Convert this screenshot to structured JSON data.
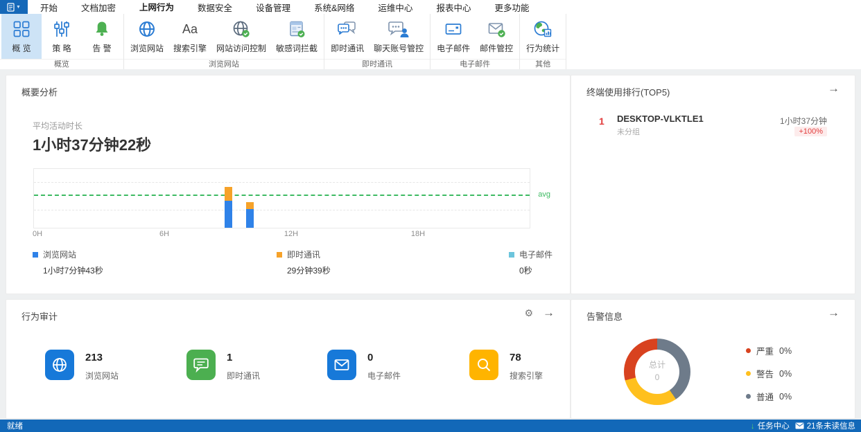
{
  "app": {
    "tabs": [
      {
        "label": "开始",
        "active": false
      },
      {
        "label": "文档加密",
        "active": false
      },
      {
        "label": "上网行为",
        "active": true
      },
      {
        "label": "数据安全",
        "active": false
      },
      {
        "label": "设备管理",
        "active": false
      },
      {
        "label": "系统&网络",
        "active": false
      },
      {
        "label": "运维中心",
        "active": false
      },
      {
        "label": "报表中心",
        "active": false
      },
      {
        "label": "更多功能",
        "active": false
      }
    ]
  },
  "ribbon": {
    "groups": [
      {
        "label": "概览",
        "items": [
          {
            "label": "概 览",
            "selected": true
          },
          {
            "label": "策 略"
          },
          {
            "label": "告 警"
          }
        ]
      },
      {
        "label": "浏览网站",
        "items": [
          {
            "label": "浏览网站"
          },
          {
            "label": "搜索引擎"
          },
          {
            "label": "网站访问控制"
          },
          {
            "label": "敏感词拦截"
          }
        ]
      },
      {
        "label": "即时通讯",
        "items": [
          {
            "label": "即时通讯"
          },
          {
            "label": "聊天账号管控"
          }
        ]
      },
      {
        "label": "电子邮件",
        "items": [
          {
            "label": "电子邮件"
          },
          {
            "label": "邮件管控"
          }
        ]
      },
      {
        "label": "其他",
        "items": [
          {
            "label": "行为统计"
          }
        ]
      }
    ]
  },
  "summary_panel": {
    "title": "概要分析",
    "avg_label": "平均活动时长",
    "avg_value": "1小时37分钟22秒"
  },
  "ranking_panel": {
    "title": "终端使用排行(TOP5)",
    "items": [
      {
        "rank": "1",
        "name": "DESKTOP-VLKTLE1",
        "group": "未分组",
        "duration": "1小时37分钟",
        "change": "+100%"
      }
    ]
  },
  "audit_panel": {
    "title": "行为审计",
    "items": [
      {
        "value": "213",
        "label": "浏览网站",
        "color": "#1779d9",
        "icon": "globe-icon"
      },
      {
        "value": "1",
        "label": "即时通讯",
        "color": "#4caf50",
        "icon": "chat-icon"
      },
      {
        "value": "0",
        "label": "电子邮件",
        "color": "#1779d9",
        "icon": "mail-icon"
      },
      {
        "value": "78",
        "label": "搜索引擎",
        "color": "#ffb400",
        "icon": "search-icon"
      }
    ]
  },
  "alarm_panel": {
    "title": "告警信息"
  },
  "statusbar": {
    "ready": "就绪",
    "task_center": "任务中心",
    "unread": "21条未读信息"
  },
  "chart_data": [
    {
      "type": "stacked-bar",
      "title": "平均活动时长",
      "x_range_hours": [
        0,
        24
      ],
      "x_ticks": [
        {
          "label": "0H",
          "hour": 0
        },
        {
          "label": "6H",
          "hour": 6
        },
        {
          "label": "12H",
          "hour": 12
        },
        {
          "label": "18H",
          "hour": 18
        }
      ],
      "y_range_minutes": [
        0,
        90
      ],
      "grid": "dashed-horizontal",
      "avg_line": {
        "label": "avg",
        "value_minutes": 49,
        "color": "#3dba62"
      },
      "series": [
        {
          "name": "浏览网站",
          "color": "#2f82e8",
          "total_label": "1小时7分钟43秒",
          "points": [
            {
              "hour": 9,
              "minutes": 41
            },
            {
              "hour": 10,
              "minutes": 29
            }
          ]
        },
        {
          "name": "即时通讯",
          "color": "#f6a229",
          "total_label": "29分钟39秒",
          "points": [
            {
              "hour": 9,
              "minutes": 21
            },
            {
              "hour": 10,
              "minutes": 10
            }
          ]
        },
        {
          "name": "电子邮件",
          "color": "#6cc5dd",
          "total_label": "0秒",
          "points": []
        }
      ]
    },
    {
      "type": "donut",
      "center_label": "总计",
      "center_value": "0",
      "legend": [
        {
          "name": "严重",
          "value": "0%",
          "color": "#d8421f"
        },
        {
          "name": "警告",
          "value": "0%",
          "color": "#ffc01e"
        },
        {
          "name": "普通",
          "value": "0%",
          "color": "#6e7b8a"
        }
      ],
      "draw_segments": [
        {
          "name": "普通",
          "color": "#6e7b8a",
          "pct": 40.5
        },
        {
          "name": "警告",
          "color": "#ffc01e",
          "pct": 30.3
        },
        {
          "name": "严重",
          "color": "#d8421f",
          "pct": 29.2
        }
      ]
    }
  ]
}
